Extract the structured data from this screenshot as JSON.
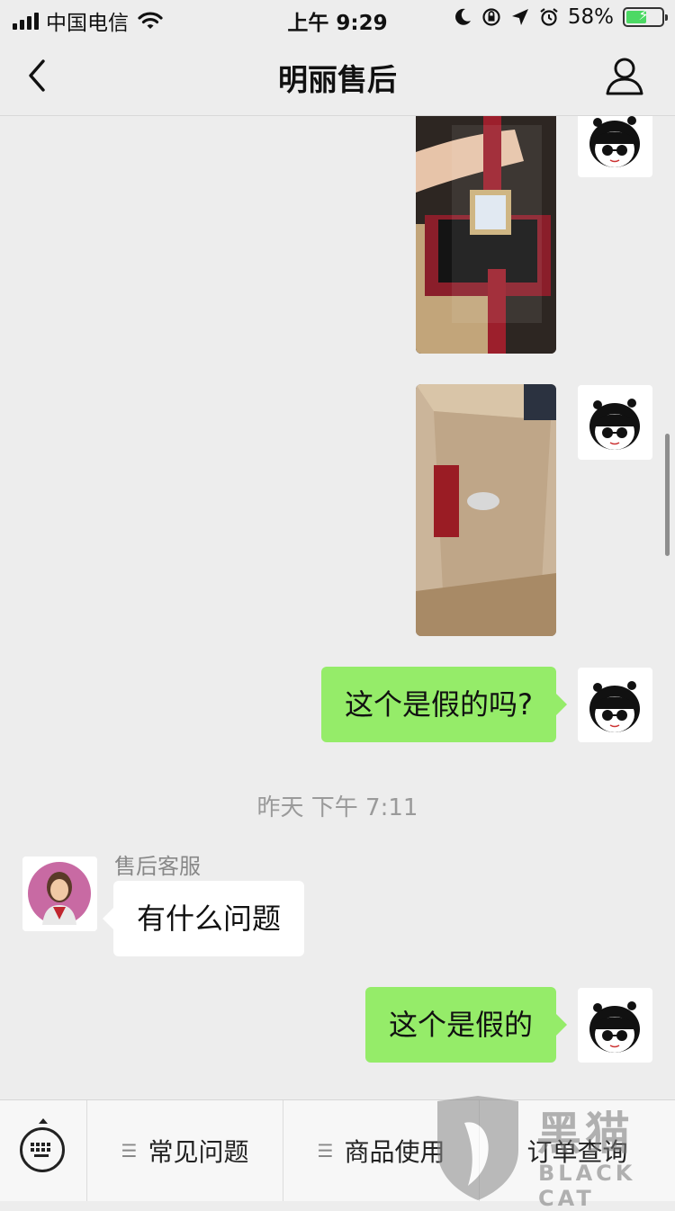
{
  "status_bar": {
    "carrier": "中国电信",
    "time": "上午 9:29",
    "battery_percent": "58%",
    "battery_level": 0.58
  },
  "nav": {
    "title": "明丽售后"
  },
  "chat": {
    "messages": [
      {
        "from": "me",
        "type": "image",
        "description": "watch-photo"
      },
      {
        "from": "me",
        "type": "image",
        "description": "box-photo"
      },
      {
        "from": "me",
        "type": "text",
        "text": "这个是假的吗?"
      },
      {
        "type": "timestamp",
        "text": "昨天 下午 7:11"
      },
      {
        "from": "cs",
        "sender": "售后客服",
        "type": "text",
        "text": "有什么问题"
      },
      {
        "from": "me",
        "type": "text",
        "text": "这个是假的"
      }
    ]
  },
  "bottom_menu": {
    "items": [
      "常见问题",
      "商品使用",
      "订单查询"
    ]
  },
  "watermark": {
    "main": "黑猫",
    "sub": "BLACK CAT"
  },
  "colors": {
    "my_bubble": "#95ec69",
    "background": "#ededed",
    "battery_fill": "#4cd964"
  }
}
